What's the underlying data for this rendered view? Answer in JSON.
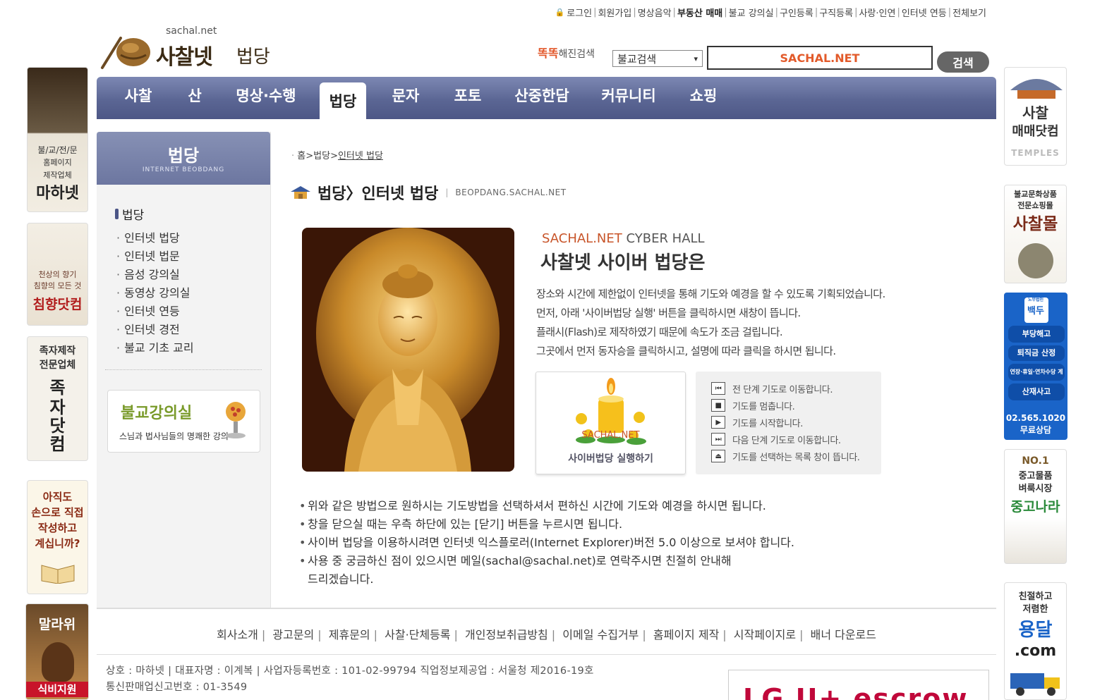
{
  "top_links": [
    "로그인",
    "회원가입",
    "명상음악",
    "부동산 매매",
    "불교 강의실",
    "구인등록",
    "구직등록",
    "사랑·인연",
    "인터넷 연등",
    "전체보기"
  ],
  "logo": {
    "domain": "sachal.net",
    "name": "사찰넷",
    "sub": "법당"
  },
  "search": {
    "brand_a": "똑똑",
    "brand_b": "해진검색",
    "select_value": "불교검색",
    "input_value": "SACHAL.NET",
    "button": "검색"
  },
  "nav": [
    "사찰",
    "산",
    "명상·수행",
    "법당",
    "문자",
    "포토",
    "산중한담",
    "커뮤니티",
    "쇼핑"
  ],
  "left_side": {
    "title": "법당",
    "subtitle": "INTERNET BEOBDANG",
    "category": "법당",
    "items": [
      "인터넷 법당",
      "인터넷 법문",
      "음성 강의실",
      "동영상 강의실",
      "인터넷 연등",
      "인터넷 경전",
      "불교 기초 교리"
    ],
    "lecture_title": "불교강의실",
    "lecture_sub": "스님과 법사님들의 명쾌한 강의"
  },
  "breadcrumb": {
    "home": "홈",
    "sep": ">",
    "section": "법당",
    "current": "인터넷 법당"
  },
  "page_title": {
    "main": "법당〉인터넷 법당",
    "eng": "BEOPDANG.SACHAL.NET"
  },
  "hall": {
    "en_a": "SACHAL.NET",
    "en_b": " CYBER HALL",
    "ko": "사찰넷 사이버 법당은",
    "desc": [
      "장소와 시간에 제한없이 인터넷을 통해 기도와 예경을 할 수 있도록 기획되었습니다.",
      "먼저, 아래 '사이버법당 실행' 버튼을 클릭하시면 새창이 뜹니다.",
      "플래시(Flash)로 제작하였기 때문에 속도가 조금 걸립니다.",
      "그곳에서 먼저 동자승을 클릭하시고, 설명에 따라 클릭을 하시면 됩니다."
    ],
    "run_label": "사이버법당 실행하기",
    "controls": [
      "전 단계 기도로 이동합니다.",
      "기도를 멈춥니다.",
      "기도를 시작합니다.",
      "다음 단계 기도로 이동합니다.",
      "기도를 선택하는 목록 창이 뜹니다."
    ]
  },
  "notes": [
    "위와 같은 방법으로 원하시는 기도방법을 선택하셔서 편하신 시간에 기도와 예경을 하시면 됩니다.",
    "창을 닫으실 때는 우측 하단에 있는 [닫기] 버튼을 누르시면 됩니다.",
    "사이버 법당을 이용하시려면 인터넷 익스플로러(Internet Explorer)버전 5.0 이상으로 보셔야 합니다.",
    "사용 중 궁금하신 점이 있으시면 메일(sachal@sachal.net)로 연락주시면 친절히 안내해",
    "드리겠습니다."
  ],
  "footer_links": [
    "회사소개",
    "광고문의",
    "제휴문의",
    "사찰·단체등록",
    "개인정보취급방침",
    "이메일 수집거부",
    "홈페이지 제작",
    "시작페이지로",
    "배너 다운로드"
  ],
  "biz": {
    "line1": "상호 : 마하넷   |   대표자명 : 이계복   |   사업자등록번호 : 101-02-99794  직업정보제공업 : 서울청 제2016-19호",
    "line2": "통신판매업신고번호 : 01-3549"
  },
  "escrow_text": "LG U+ escrow",
  "left_banners": [
    {
      "lines": [
        "불/교/전/문",
        "홈페이지",
        "제작업체",
        "마하넷"
      ]
    },
    {
      "lines": [
        "천상의 향기",
        "침향의 모든 것",
        "침향닷컴"
      ]
    },
    {
      "lines": [
        "족자제작",
        "전문업체",
        "족",
        "자",
        "닷",
        "컴"
      ]
    },
    {
      "lines": [
        "아직도",
        "손으로 직접",
        "작성하고",
        "계십니까?"
      ]
    },
    {
      "lines": [
        "말라위",
        "식비지원"
      ]
    }
  ],
  "right_banners": [
    {
      "lines": [
        "사찰",
        "매매닷컴",
        "TEMPLES"
      ]
    },
    {
      "lines": [
        "불교문화상품",
        "전문쇼핑몰",
        "사찰몰"
      ]
    },
    {
      "lines": [
        "노무법인",
        "백두",
        "부당해고",
        "퇴직금 산정",
        "연장·휴일·연차수당 계산",
        "산재사고",
        "02.565.1020",
        "무료상담"
      ]
    },
    {
      "lines": [
        "NO.1",
        "중고물품",
        "벼룩시장",
        "중고나라"
      ]
    },
    {
      "lines": [
        "친절하고",
        "저렴한",
        "용달",
        ".com"
      ]
    }
  ]
}
